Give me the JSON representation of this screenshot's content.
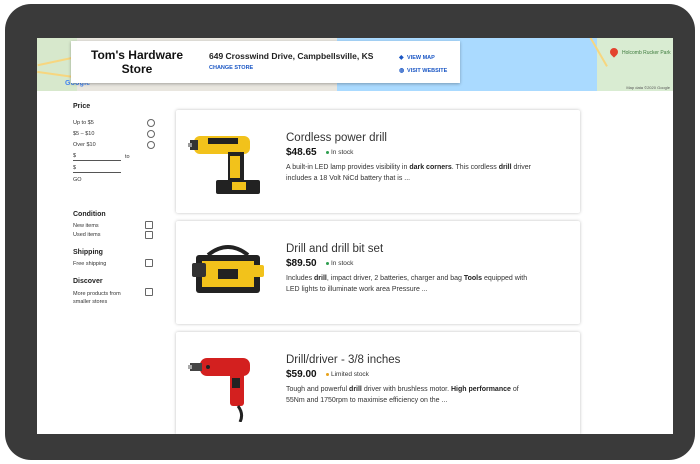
{
  "store": {
    "name": "Tom's Hardware Store",
    "address": "649 Crosswind Drive, Campbellsville, KS",
    "change_store": "CHANGE STORE",
    "view_map": "VIEW MAP",
    "visit_website": "VISIT WEBSITE"
  },
  "map": {
    "pin_label": "Holcomb Rucker Park",
    "google_logo": "Google",
    "map_data": "Map data ©2020 Google"
  },
  "filters": {
    "price_heading": "Price",
    "price_options": [
      "Up to $5",
      "$5 – $10",
      "Over $10"
    ],
    "min_prefix": "$",
    "to_label": "to",
    "max_prefix": "$",
    "go_label": "GO",
    "condition_heading": "Condition",
    "condition_options": [
      "New items",
      "Used items"
    ],
    "shipping_heading": "Shipping",
    "shipping_options": [
      "Free shipping"
    ],
    "discover_heading": "Discover",
    "discover_options": [
      "More products from smaller stores"
    ]
  },
  "products": [
    {
      "title": "Cordless power drill",
      "price": "$48.65",
      "stock": "In stock",
      "desc_1": "A built-in LED lamp provides visibility in ",
      "desc_b1": "dark corners",
      "desc_2": ". This cordless ",
      "desc_b2": "drill",
      "desc_3": " driver includes a 18 Volt NiCd battery that is ..."
    },
    {
      "title": "Drill and drill bit set",
      "price": "$89.50",
      "stock": "In stock",
      "desc_1": "Includes ",
      "desc_b1": "drill",
      "desc_2": ", impact driver, 2 batteries, charger and bag ",
      "desc_b2": "Tools",
      "desc_3": " equipped with LED lights to illuminate work area Pressure ..."
    },
    {
      "title": "Drill/driver - 3/8 inches",
      "price": "$59.00",
      "stock": "Limited stock",
      "desc_1": "Tough and powerful ",
      "desc_b1": "drill",
      "desc_2": " driver with brushless motor. ",
      "desc_b2": "High performance",
      "desc_3": " of 55Nm and 1750rpm to maximise efficiency on the ..."
    }
  ],
  "colors": {
    "link": "#1a56c4",
    "in_stock": "#2e9e4f",
    "limited_stock": "#e8a21a",
    "frame": "#3a3a3a"
  },
  "icons": {
    "view_map": "diamond-direction-icon",
    "visit_website": "globe-icon",
    "map_pin": "map-pin-icon"
  }
}
